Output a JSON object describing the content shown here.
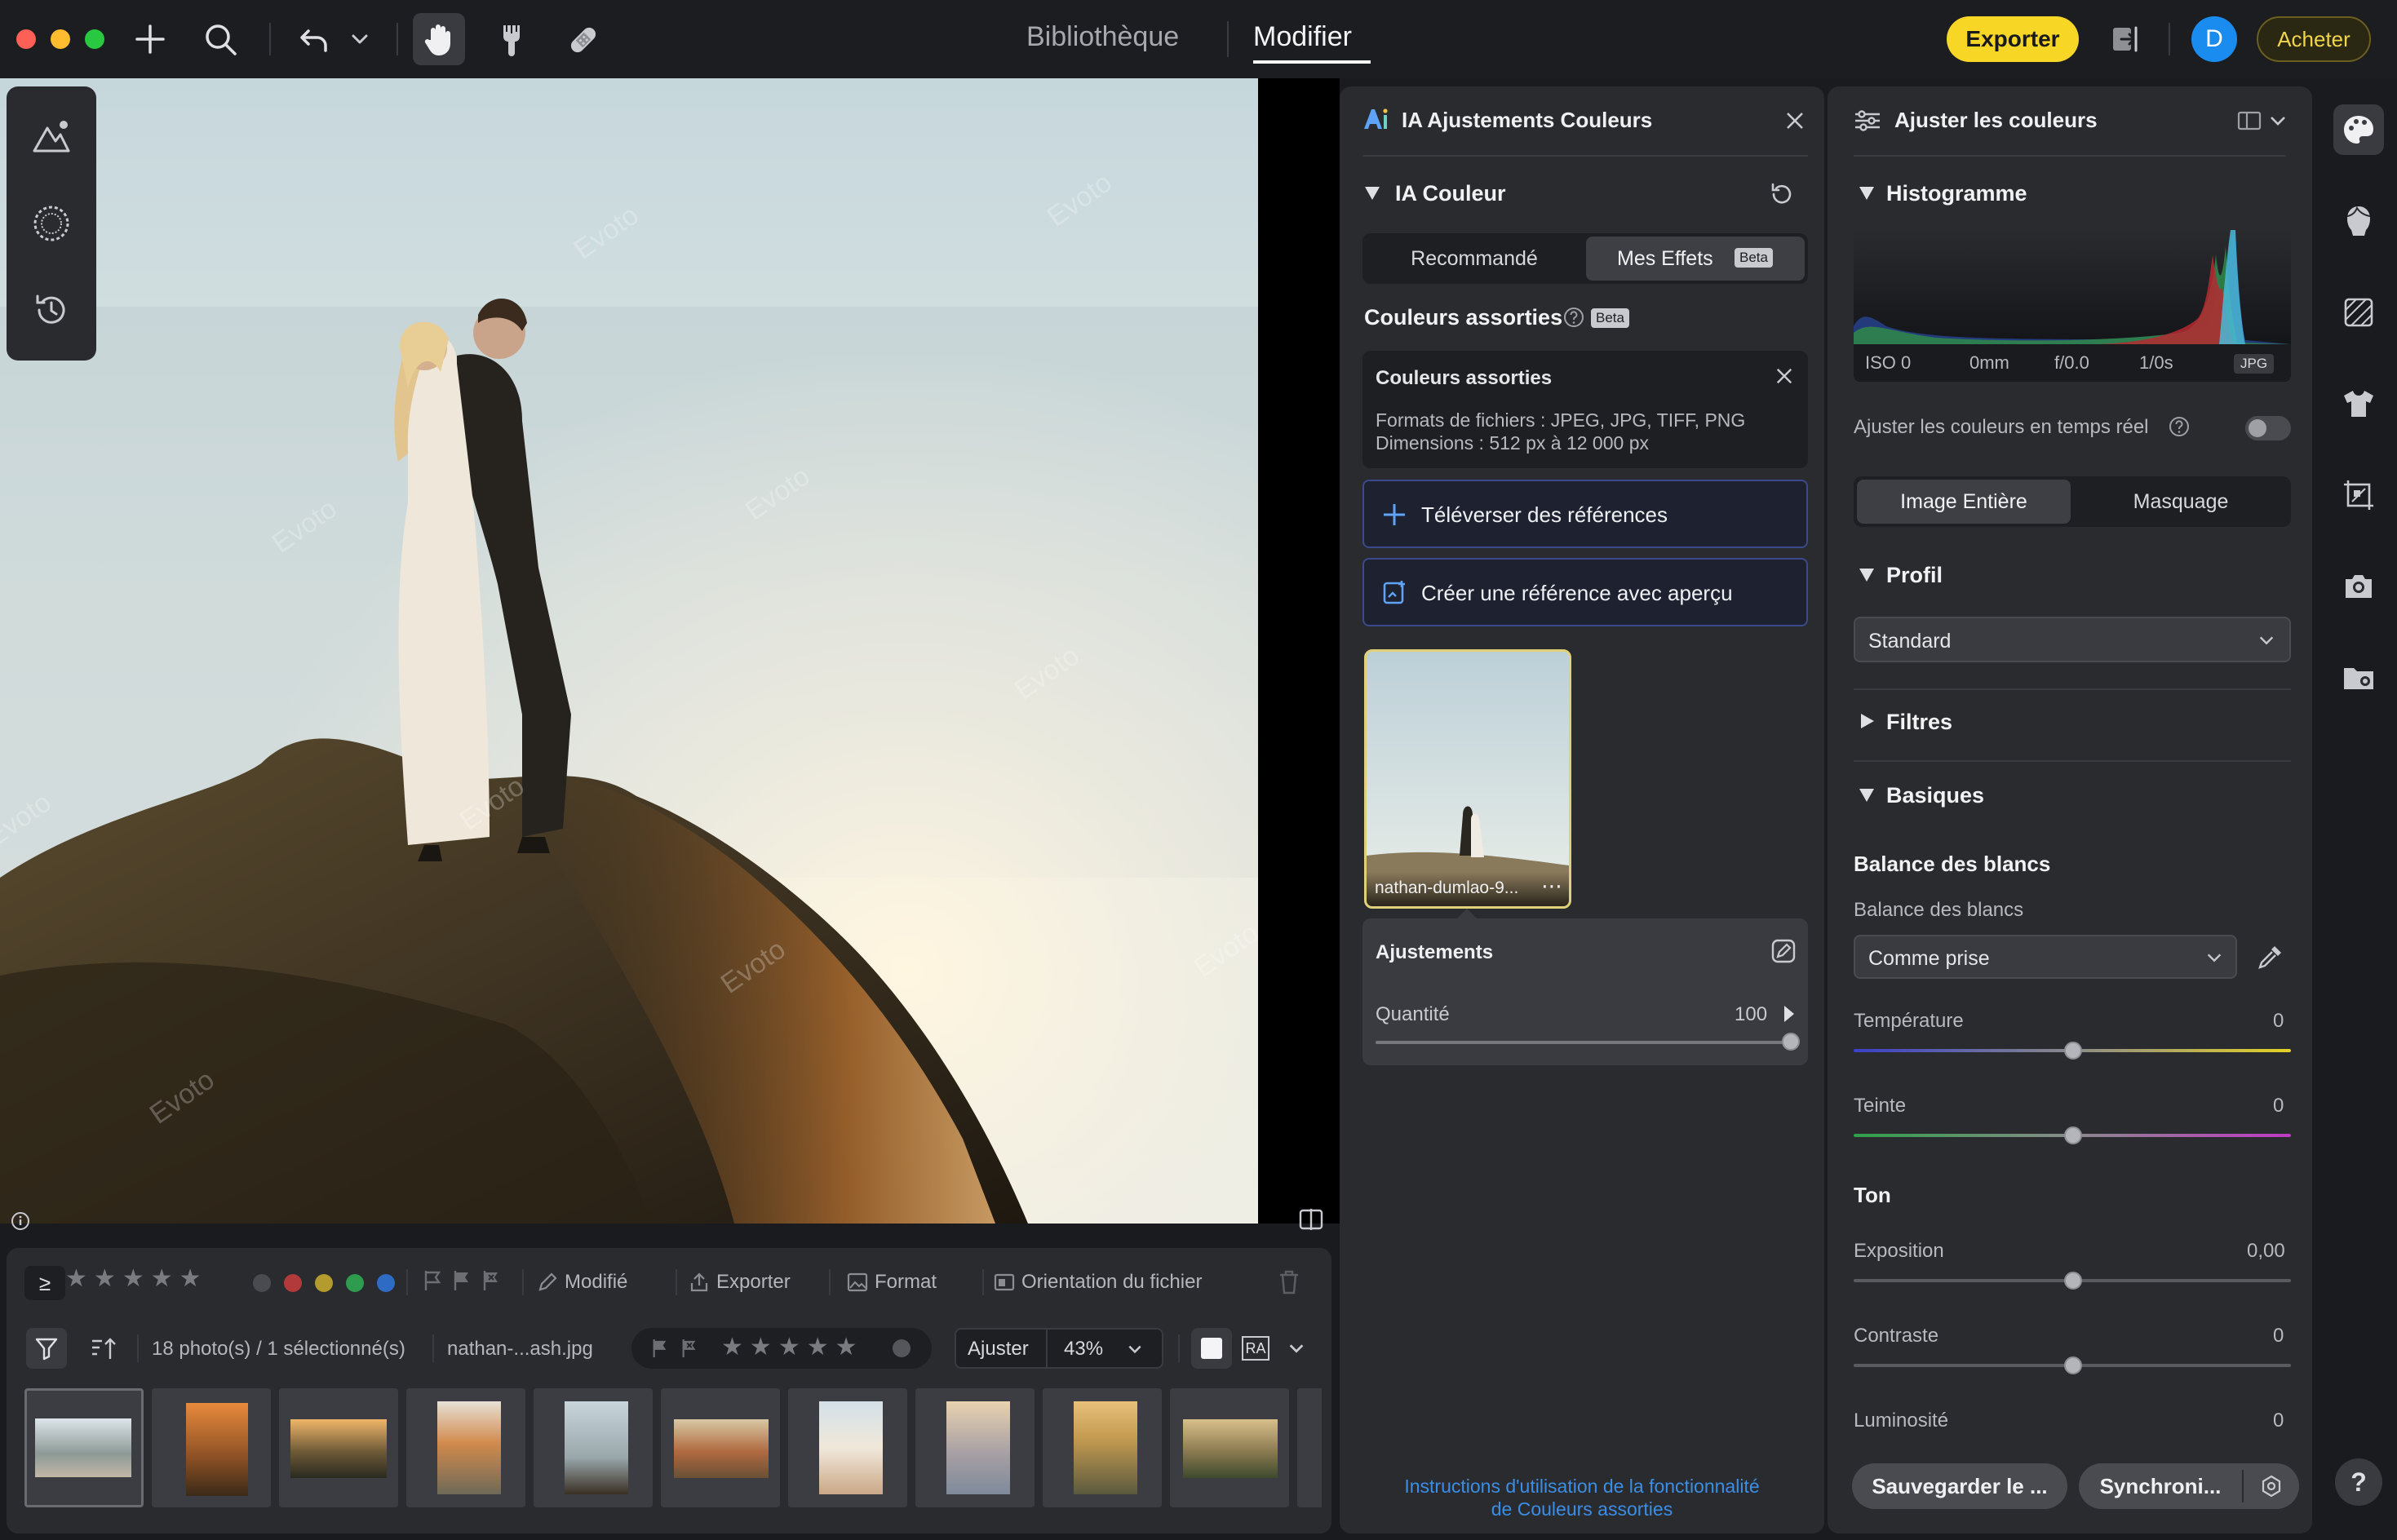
{
  "top": {
    "nav_library": "Bibliothèque",
    "nav_edit": "Modifier",
    "export_label": "Exporter",
    "avatar_letter": "D",
    "buy_label": "Acheter"
  },
  "watermark": "Evoto",
  "ai_panel": {
    "title": "IA Ajustements Couleurs",
    "section": "IA Couleur",
    "tab_recommended": "Recommandé",
    "tab_my_effects": "Mes Effets",
    "beta": "Beta",
    "matched_colors": "Couleurs assorties",
    "info_title": "Couleurs assorties",
    "info_formats": "Formats de fichiers : JPEG, JPG, TIFF, PNG",
    "info_dimensions": "Dimensions : 512 px à 12 000 px",
    "upload_refs": "Téléverser des références",
    "create_ref": "Créer une référence avec aperçu",
    "ref_filename": "nathan-dumlao-9...",
    "adjustments": "Ajustements",
    "quantity_label": "Quantité",
    "quantity_value": "100",
    "help_link_1": "Instructions d'utilisation de la fonctionnalité",
    "help_link_2": "de Couleurs assorties"
  },
  "adjust_panel": {
    "title": "Ajuster les couleurs",
    "histogram": "Histogramme",
    "exif": {
      "iso": "ISO 0",
      "focal": "0mm",
      "aperture": "f/0.0",
      "shutter": "1/0s",
      "format": "JPG"
    },
    "realtime": "Ajuster les couleurs en temps réel",
    "tab_full": "Image Entière",
    "tab_mask": "Masquage",
    "profile": "Profil",
    "profile_value": "Standard",
    "filters": "Filtres",
    "basics": "Basiques",
    "wb_header": "Balance des blancs",
    "wb_label": "Balance des blancs",
    "wb_value": "Comme prise",
    "temperature": "Température",
    "temperature_value": "0",
    "tint": "Teinte",
    "tint_value": "0",
    "tone": "Ton",
    "exposure": "Exposition",
    "exposure_value": "0,00",
    "contrast": "Contraste",
    "contrast_value": "0",
    "brightness": "Luminosité",
    "brightness_value": "0",
    "save_label": "Sauvegarder le ...",
    "sync_label": "Synchroni..."
  },
  "filmstrip": {
    "modified": "Modifié",
    "export": "Exporter",
    "format": "Format",
    "orientation": "Orientation du fichier",
    "count": "18 photo(s) / 1 sélectionné(s)",
    "filename": "nathan-...ash.jpg",
    "fit": "Ajuster",
    "zoom": "43%",
    "ra": "RA"
  },
  "colors": {
    "accent_yellow": "#f7d626",
    "link_blue": "#3a8ee6",
    "avatar_blue": "#1a8cf0"
  }
}
